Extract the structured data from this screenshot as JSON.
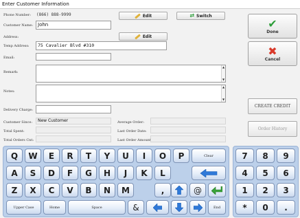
{
  "window": {
    "title": "Enter Customer Information"
  },
  "form": {
    "phone": {
      "label": "Phone Number:",
      "value": "(866) 888-9999"
    },
    "customer_name": {
      "label": "Customer Name:",
      "value": "John"
    },
    "address": {
      "label": "Address:",
      "value": ""
    },
    "temp_address": {
      "label": "Temp Address:",
      "value": "75 Cavalier Blvd #310"
    },
    "email": {
      "label": "Email:",
      "value": ""
    },
    "remark": {
      "label": "Remark:",
      "value": ""
    },
    "notes": {
      "label": "Notes:",
      "value": ""
    },
    "delivery_charge": {
      "label": "Delivery Charge:",
      "value": ""
    }
  },
  "buttons": {
    "edit_phone": "Edit",
    "switch": "Switch",
    "edit_address": "Edit",
    "done": "Done",
    "cancel": "Cancel",
    "create_credit": "CREATE CREDIT",
    "order_history": "Order History"
  },
  "stats": {
    "customer_since": {
      "label": "Customer Since:",
      "value": "New Customer"
    },
    "total_spent": {
      "label": "Total Spent:",
      "value": ""
    },
    "total_orders_cnt": {
      "label": "Total Orders Cnt:",
      "value": ""
    },
    "average_order": {
      "label": "Average Order:",
      "value": ""
    },
    "last_order_date": {
      "label": "Last Order Date:",
      "value": ""
    },
    "last_order_amount": {
      "label": "Last Order Amount:",
      "value": ""
    }
  },
  "keyboard": {
    "row1": [
      "Q",
      "W",
      "E",
      "R",
      "T",
      "Y",
      "U",
      "I",
      "O",
      "P"
    ],
    "clear": "Clear",
    "row2": [
      "A",
      "S",
      "D",
      "F",
      "G",
      "H",
      "J",
      "K",
      "L"
    ],
    "row3": [
      "Z",
      "X",
      "C",
      "V",
      "B",
      "N",
      "M"
    ],
    "comma": ",",
    "at": "@",
    "upper_case": "Upper Case",
    "home": "Home",
    "space": "Space",
    "ampersand": "&",
    "end": "End"
  },
  "numpad": [
    "7",
    "8",
    "9",
    "4",
    "5",
    "6",
    "1",
    "2",
    "3",
    "*",
    "0",
    "."
  ],
  "colors": {
    "keyboard_bg": "#bcd0ea",
    "arrow": "#2f79d8",
    "done_check": "#2e9e3a",
    "cancel_x": "#d93a2b"
  }
}
